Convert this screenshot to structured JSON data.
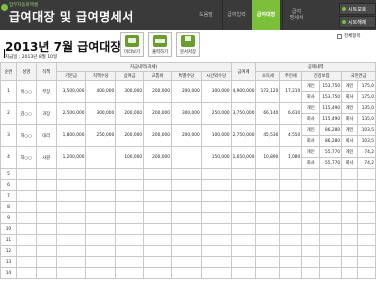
{
  "header": {
    "logo_sub": "업무자동화엑셀",
    "logo_main": "급여대장 및 급여명세서",
    "nav": [
      {
        "label": "도움말",
        "active": false
      },
      {
        "label": "급여입력",
        "active": false
      },
      {
        "label": "급여대장",
        "active": true
      },
      {
        "label": "급여\n명세서",
        "active": false
      }
    ],
    "side_buttons": [
      "시트보호",
      "시트해제"
    ]
  },
  "title": "2013년 7월 급여대장",
  "paydate": "지급일 : 2013년 8월 10일",
  "toolbar": {
    "preview": "미리보기",
    "print": "출력하기",
    "save": "문서저장"
  },
  "checkbox_label": "전체항목",
  "table": {
    "group_pay": "지급내역(과세)",
    "group_deduct": "공제내역",
    "headers": [
      "순번",
      "성명",
      "직책",
      "기본급",
      "직책수당",
      "상여금",
      "교통비",
      "특별수당",
      "시간외수당",
      "급여계",
      "소득세",
      "주민세",
      "건강보험",
      "국민연금"
    ],
    "rows": [
      {
        "no": "1",
        "name": "이○○",
        "pos": "부장",
        "base": "3,500,000",
        "duty": "400,000",
        "bonus": "300,000",
        "trans": "200,000",
        "special": "200,000",
        "ot": "300,000",
        "total": "4,900,000",
        "tax": "172,120",
        "res": "17,210",
        "health": [
          [
            "개인",
            "153,750",
            "개인",
            "175,0"
          ],
          [
            "회사",
            "153,750",
            "회사",
            "175,0"
          ]
        ]
      },
      {
        "no": "2",
        "name": "김○○",
        "pos": "과장",
        "base": "2,500,000",
        "duty": "300,000",
        "bonus": "200,000",
        "trans": "200,000",
        "special": "300,000",
        "ot": "250,000",
        "total": "3,750,000",
        "tax": "66,140",
        "res": "6,610",
        "health": [
          [
            "개인",
            "115,490",
            "개인",
            "135,0"
          ],
          [
            "회사",
            "115,490",
            "회사",
            "135,0"
          ]
        ]
      },
      {
        "no": "3",
        "name": "허○○",
        "pos": "대리",
        "base": "1,800,000",
        "duty": "250,000",
        "bonus": "200,000",
        "trans": "200,000",
        "special": "200,000",
        "ot": "100,000",
        "total": "2,750,000",
        "tax": "45,530",
        "res": "4,550",
        "health": [
          [
            "개인",
            "86,280",
            "개인",
            "103,5"
          ],
          [
            "회사",
            "86,280",
            "회사",
            "103,5"
          ]
        ]
      },
      {
        "no": "4",
        "name": "차○○",
        "pos": "사원",
        "base": "1,200,000",
        "duty": "",
        "bonus": "100,000",
        "trans": "200,000",
        "special": "",
        "ot": "150,000",
        "total": "1,650,000",
        "tax": "10,890",
        "res": "1,080",
        "health": [
          [
            "개인",
            "55,770",
            "개인",
            "74,2"
          ],
          [
            "회사",
            "55,770",
            "회사",
            "74,2"
          ]
        ]
      }
    ],
    "empty_rows": [
      "5",
      "6",
      "7",
      "8",
      "9",
      "10",
      "11",
      "12",
      "13",
      "14"
    ]
  }
}
